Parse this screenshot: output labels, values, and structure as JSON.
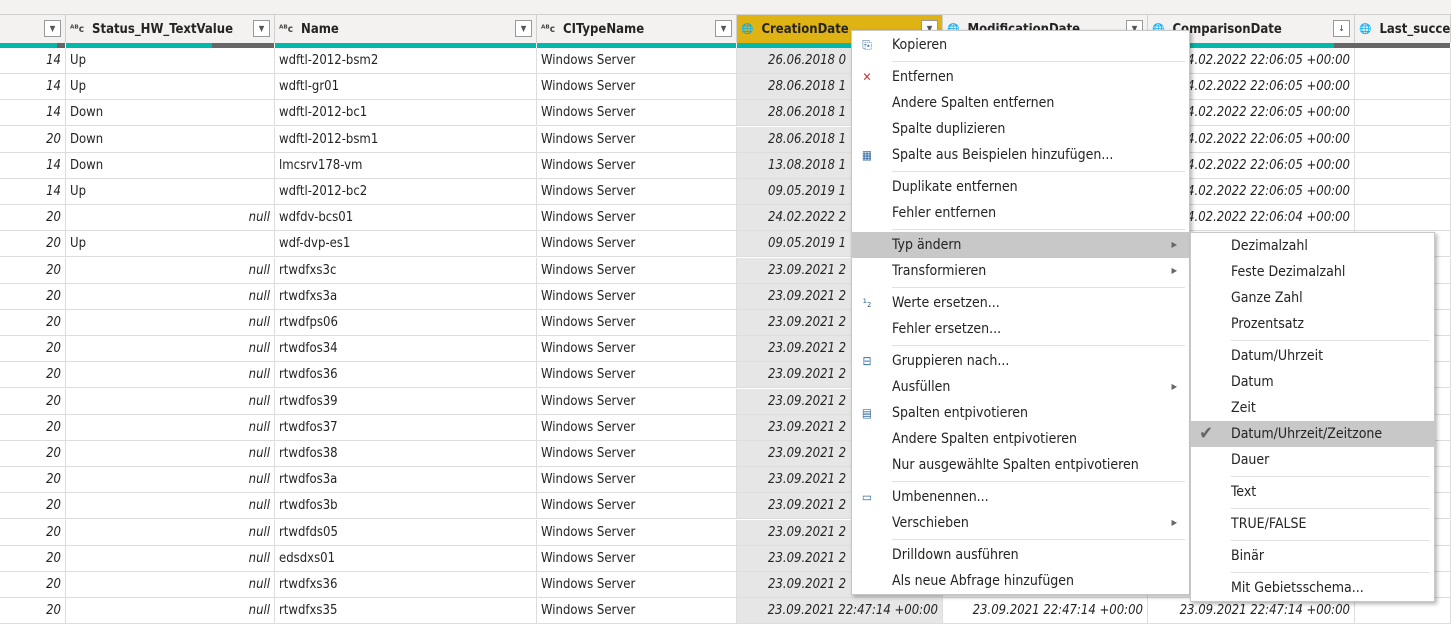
{
  "columns": [
    {
      "label": "",
      "type": ""
    },
    {
      "label": "Status_HW_TextValue",
      "type": "ABC"
    },
    {
      "label": "Name",
      "type": "ABC"
    },
    {
      "label": "CITypeName",
      "type": "ABC"
    },
    {
      "label": "CreationDate",
      "type": "globe-clock"
    },
    {
      "label": "ModificationDate",
      "type": "globe-clock"
    },
    {
      "label": "ComparisonDate",
      "type": "globe-clock"
    },
    {
      "label": "Last_succe",
      "type": "globe-clock"
    }
  ],
  "rows": [
    [
      "14",
      "Up",
      "wdftl-2012-bsm2",
      "Windows Server",
      "26.06.2018 0",
      "",
      "24.02.2022 22:06:05 +00:00"
    ],
    [
      "14",
      "Up",
      "wdftl-gr01",
      "Windows Server",
      "28.06.2018 1",
      "",
      "24.02.2022 22:06:05 +00:00"
    ],
    [
      "14",
      "Down",
      "wdftl-2012-bc1",
      "Windows Server",
      "28.06.2018 1",
      "",
      "24.02.2022 22:06:05 +00:00"
    ],
    [
      "20",
      "Down",
      "wdftl-2012-bsm1",
      "Windows Server",
      "28.06.2018 1",
      "",
      "24.02.2022 22:06:05 +00:00"
    ],
    [
      "14",
      "Down",
      "lmcsrv178-vm",
      "Windows Server",
      "13.08.2018 1",
      "",
      "24.02.2022 22:06:05 +00:00"
    ],
    [
      "14",
      "Up",
      "wdftl-2012-bc2",
      "Windows Server",
      "09.05.2019 1",
      "",
      "24.02.2022 22:06:05 +00:00"
    ],
    [
      "20",
      "null",
      "wdfdv-bcs01",
      "Windows Server",
      "24.02.2022 2",
      "",
      "24.02.2022 22:06:04 +00:00"
    ],
    [
      "20",
      "Up",
      "wdf-dvp-es1",
      "Windows Server",
      "09.05.2019 1",
      "",
      ""
    ],
    [
      "20",
      "null",
      "rtwdfxs3c",
      "Windows Server",
      "23.09.2021 2",
      "",
      ""
    ],
    [
      "20",
      "null",
      "rtwdfxs3a",
      "Windows Server",
      "23.09.2021 2",
      "",
      ""
    ],
    [
      "20",
      "null",
      "rtwdfps06",
      "Windows Server",
      "23.09.2021 2",
      "",
      ""
    ],
    [
      "20",
      "null",
      "rtwdfos34",
      "Windows Server",
      "23.09.2021 2",
      "",
      ""
    ],
    [
      "20",
      "null",
      "rtwdfos36",
      "Windows Server",
      "23.09.2021 2",
      "",
      ""
    ],
    [
      "20",
      "null",
      "rtwdfos39",
      "Windows Server",
      "23.09.2021 2",
      "",
      ""
    ],
    [
      "20",
      "null",
      "rtwdfos37",
      "Windows Server",
      "23.09.2021 2",
      "",
      ""
    ],
    [
      "20",
      "null",
      "rtwdfos38",
      "Windows Server",
      "23.09.2021 2",
      "",
      ""
    ],
    [
      "20",
      "null",
      "rtwdfos3a",
      "Windows Server",
      "23.09.2021 2",
      "",
      ""
    ],
    [
      "20",
      "null",
      "rtwdfos3b",
      "Windows Server",
      "23.09.2021 2",
      "",
      ""
    ],
    [
      "20",
      "null",
      "rtwdfds05",
      "Windows Server",
      "23.09.2021 2",
      "",
      ""
    ],
    [
      "20",
      "null",
      "edsdxs01",
      "Windows Server",
      "23.09.2021 2",
      "",
      ""
    ],
    [
      "20",
      "null",
      "rtwdfxs36",
      "Windows Server",
      "23.09.2021 2",
      "",
      ""
    ],
    [
      "20",
      "null",
      "rtwdfxs35",
      "Windows Server",
      "23.09.2021 22:47:14 +00:00",
      "23.09.2021 22:47:14 +00:00",
      "23.09.2021 22:47:14 +00:00"
    ]
  ],
  "context_menu": [
    {
      "label": "Kopieren",
      "icon": "copy-icon"
    },
    {
      "sep": true
    },
    {
      "label": "Entfernen",
      "icon": "remove-column-icon"
    },
    {
      "label": "Andere Spalten entfernen"
    },
    {
      "label": "Spalte duplizieren"
    },
    {
      "label": "Spalte aus Beispielen hinzufügen...",
      "icon": "column-from-examples-icon"
    },
    {
      "sep": true
    },
    {
      "label": "Duplikate entfernen"
    },
    {
      "label": "Fehler entfernen"
    },
    {
      "sep": true
    },
    {
      "label": "Typ ändern",
      "submenu": true,
      "highlighted": true
    },
    {
      "label": "Transformieren",
      "submenu": true
    },
    {
      "sep": true
    },
    {
      "label": "Werte ersetzen...",
      "icon": "replace-values-icon"
    },
    {
      "label": "Fehler ersetzen..."
    },
    {
      "sep": true
    },
    {
      "label": "Gruppieren nach...",
      "icon": "group-by-icon"
    },
    {
      "label": "Ausfüllen",
      "submenu": true
    },
    {
      "label": "Spalten entpivotieren",
      "icon": "unpivot-icon"
    },
    {
      "label": "Andere Spalten entpivotieren"
    },
    {
      "label": "Nur ausgewählte Spalten entpivotieren"
    },
    {
      "sep": true
    },
    {
      "label": "Umbenennen...",
      "icon": "rename-icon"
    },
    {
      "label": "Verschieben",
      "submenu": true
    },
    {
      "sep": true
    },
    {
      "label": "Drilldown ausführen"
    },
    {
      "label": "Als neue Abfrage hinzufügen"
    }
  ],
  "type_submenu": [
    {
      "label": "Dezimalzahl"
    },
    {
      "label": "Feste Dezimalzahl"
    },
    {
      "label": "Ganze Zahl"
    },
    {
      "label": "Prozentsatz"
    },
    {
      "sep": true
    },
    {
      "label": "Datum/Uhrzeit"
    },
    {
      "label": "Datum"
    },
    {
      "label": "Zeit"
    },
    {
      "label": "Datum/Uhrzeit/Zeitzone",
      "checked": true,
      "highlighted": true
    },
    {
      "label": "Dauer"
    },
    {
      "sep": true
    },
    {
      "label": "Text"
    },
    {
      "sep": true
    },
    {
      "label": "TRUE/FALSE"
    },
    {
      "sep": true
    },
    {
      "label": "Binär"
    },
    {
      "sep": true
    },
    {
      "label": "Mit Gebietsschema..."
    }
  ],
  "colors": {
    "quality_bar": "#01b8aa",
    "selected_header": "#dfb313",
    "selected_column": "#e6e6e6",
    "menu_highlight": "#c8c8c8"
  }
}
